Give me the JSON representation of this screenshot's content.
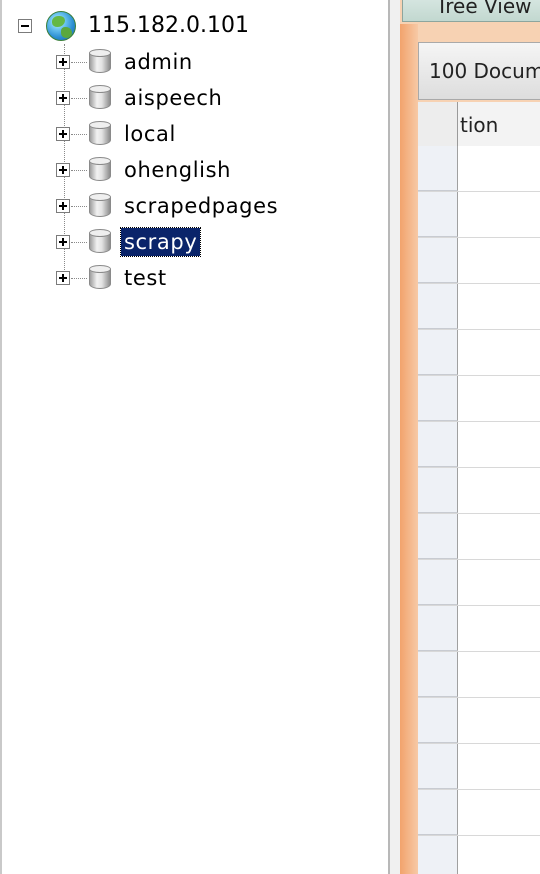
{
  "tree": {
    "root": {
      "label": "115.182.0.101",
      "icon": "globe-icon",
      "expanded": true
    },
    "databases": [
      {
        "label": "admin",
        "icon": "database-icon",
        "selected": false
      },
      {
        "label": "aispeech",
        "icon": "database-icon",
        "selected": false
      },
      {
        "label": "local",
        "icon": "database-icon",
        "selected": false
      },
      {
        "label": "ohenglish",
        "icon": "database-icon",
        "selected": false
      },
      {
        "label": "scrapedpages",
        "icon": "database-icon",
        "selected": false
      },
      {
        "label": "scrapy",
        "icon": "database-icon",
        "selected": true
      },
      {
        "label": "test",
        "icon": "database-icon",
        "selected": false
      }
    ]
  },
  "right_pane": {
    "tab_label": "Tree View",
    "documents_label": "100 Docum",
    "column_header": "tion"
  },
  "colors": {
    "selection_bg": "#0a246a",
    "selection_fg": "#ffffff",
    "accent_orange": "#f2a36c"
  }
}
